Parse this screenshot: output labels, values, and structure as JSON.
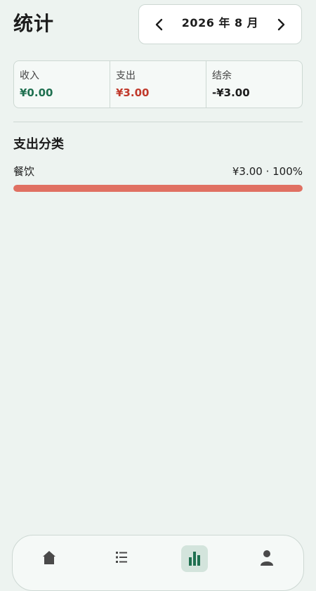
{
  "header": {
    "title": "统计",
    "month_label": "2026 年 8 月"
  },
  "summary": {
    "income_label": "收入",
    "income_value": "¥0.00",
    "expense_label": "支出",
    "expense_value": "¥3.00",
    "balance_label": "结余",
    "balance_value": "-¥3.00"
  },
  "expense_categories": {
    "title": "支出分类",
    "items": [
      {
        "name": "餐饮",
        "amount_text": "¥3.00 · 100%",
        "fraction": 1.0
      }
    ]
  },
  "bottom_nav": {
    "items": [
      {
        "icon": "home-icon",
        "active": false
      },
      {
        "icon": "list-icon",
        "active": false
      },
      {
        "icon": "bar-chart-icon",
        "active": true
      },
      {
        "icon": "user-icon",
        "active": false
      }
    ]
  },
  "colors": {
    "income": "#1f7050",
    "expense": "#c0392b",
    "bar": "#e07062",
    "active_nav": "#1f7050"
  }
}
